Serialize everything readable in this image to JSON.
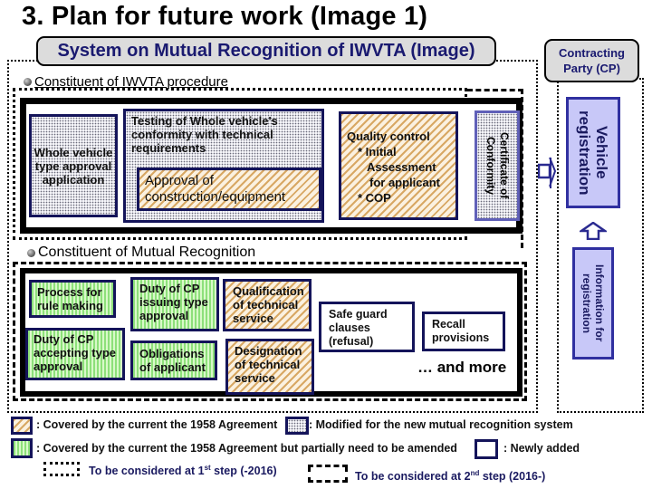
{
  "title": "3. Plan for future work (Image 1)",
  "header": {
    "system_title": "System on Mutual Recognition of IWVTA (Image)",
    "contracting_party": "Contracting Party (CP)"
  },
  "iwvta_section": {
    "label": "Constituent of IWVTA procedure",
    "boxes": {
      "whole_vehicle": "Whole vehicle type approval application",
      "testing": "Testing of Whole vehicle's conformity with technical requirements",
      "approval": "Approval of construction/equipment",
      "quality_title": "Quality control",
      "quality_items": [
        "* Initial",
        "Assessment",
        "for applicant",
        "* COP"
      ],
      "certificate": "Certificate of Conformity"
    }
  },
  "cp_column": {
    "vehicle_registration": "Vehicle registration",
    "information_for_registration": "Information for registration"
  },
  "mr_section": {
    "label": "Constituent of Mutual Recognition",
    "boxes": {
      "process_rule": "Process for rule making",
      "duty_issuing": "Duty of CP issuing type approval",
      "qualification": "Qualification of technical service",
      "duty_accepting": "Duty of CP accepting type approval",
      "obligations": "Obligations of applicant",
      "designation": "Designation of technical service",
      "safe_guard": "Safe guard clauses (refusal)",
      "recall": "Recall provisions",
      "and_more": "… and more"
    }
  },
  "legend": {
    "covered_1958": ": Covered by the current the 1958 Agreement",
    "modified": ": Modified for the new mutual recognition system",
    "covered_partial": ": Covered by the current the 1958 Agreement but partially need to be amended",
    "newly_added": ": Newly added",
    "step1_prefix": "To be considered at 1",
    "step1_sup": "st",
    "step1_suffix": " step (-2016)",
    "step2_prefix": "To be considered at 2",
    "step2_sup": "nd",
    "step2_suffix": " step (2016-)"
  },
  "colors": {
    "navy": "#14145a",
    "header_text": "#1a1a70",
    "header_bg": "#dcdcdc",
    "cp_box_fill": "#c8c8f8",
    "cp_box_border": "#3030a0",
    "hatch_orange": "#d8a864",
    "green_stripe": "#8de07a"
  }
}
